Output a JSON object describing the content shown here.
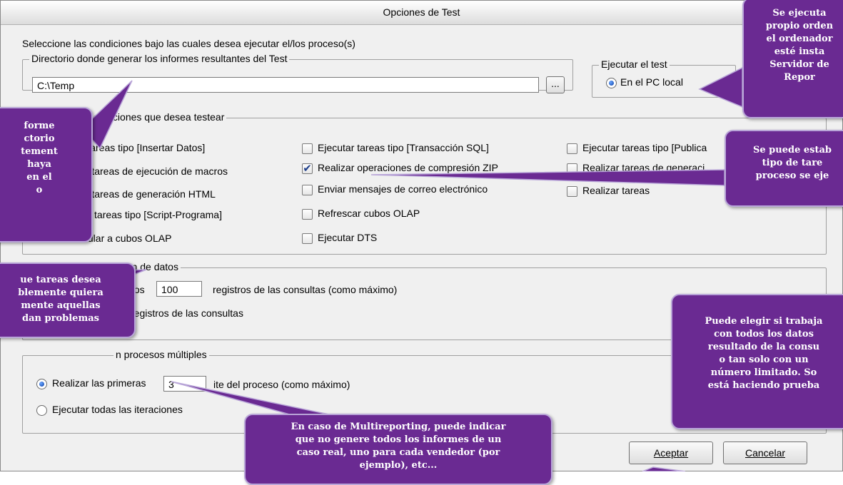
{
  "window": {
    "title": "Opciones de Test"
  },
  "intro": "Seleccione las condiciones bajo las cuales desea ejecutar el/los proceso(s)",
  "directory": {
    "legend": "Directorio donde generar los informes resultantes del Test",
    "value": "C:\\Temp",
    "browse_label": "..."
  },
  "execute": {
    "legend": "Ejecutar el test",
    "option_local": "En el PC local"
  },
  "options": {
    "legend": "ione opciones que desea testear",
    "col1": [
      "ar tareas tipo [Insertar Datos]",
      "alizar tareas de ejecución de macros",
      "alizar tareas de generación HTML",
      "cutar tareas tipo [Script-Programa]",
      "incular a cubos OLAP"
    ],
    "col2": [
      "Ejecutar tareas tipo [Transacción SQL]",
      "Realizar operaciones de compresión ZIP",
      "Enviar mensajes de correo electrónico",
      "Refrescar cubos OLAP",
      "Ejecutar DTS"
    ],
    "col3": [
      "Ejecutar tareas tipo [Publica",
      "Realizar tareas de generaci",
      "Realizar tareas"
    ]
  },
  "insertion": {
    "legend": "rción de datos",
    "prefix": "tos",
    "max_value": "100",
    "max_suffix": "registros de las consultas (como máximo)",
    "all_label": "registros de las consultas"
  },
  "multi": {
    "legend": "n procesos múltiples",
    "first_label": "Realizar las primeras",
    "first_value": "3",
    "first_suffix": "ite          del proceso (como máximo)",
    "all_label": "Ejecutar todas las iteraciones"
  },
  "buttons": {
    "accept": "Aceptar",
    "cancel": "Cancelar"
  },
  "callouts": {
    "top_right": [
      "Se ejecuta",
      "propio orden",
      "el ordenador",
      "esté insta",
      "Servidor de",
      "Repor"
    ],
    "left_top": [
      "forme",
      "ctorio",
      "tement",
      "haya",
      "en el",
      "o"
    ],
    "mid_right": [
      "Se puede estab",
      "tipo de tare",
      "proceso se eje"
    ],
    "left_mid": [
      "ue tareas desea",
      "blemente quiera",
      "mente aquellas",
      "dan problemas"
    ],
    "right_bottom": [
      "Puede elegir si trabaja",
      "con todos los datos",
      "resultado de la consu",
      "o tan solo con un",
      "número limitado. So",
      "está haciendo prueba"
    ],
    "bottom": [
      "En caso de Multireporting, puede indicar",
      "que no genere todos los informes de un",
      "caso real, uno para cada vendedor (por",
      "ejemplo), etc..."
    ]
  },
  "colors": {
    "callout_bg": "#6a2a92",
    "callout_border": "#b9a6d8",
    "dialog_bg": "#f0f0f0"
  }
}
